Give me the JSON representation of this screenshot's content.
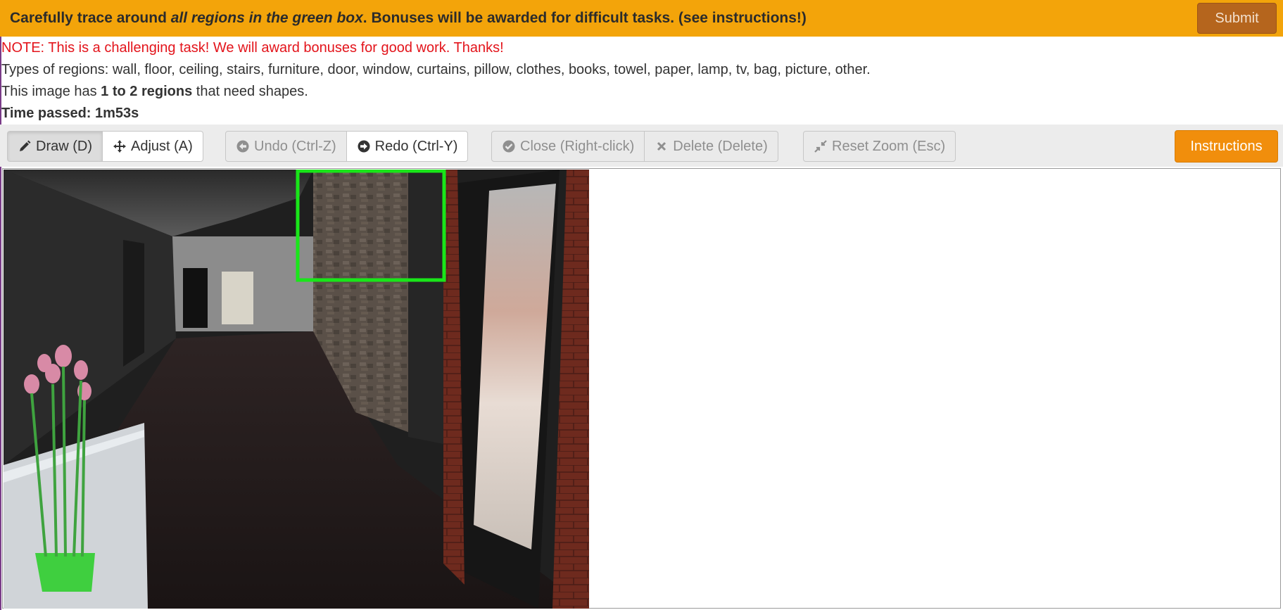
{
  "banner": {
    "part1": "Carefully trace around ",
    "emphasis": "all regions in the green box",
    "part2": ". Bonuses will be awarded for difficult tasks. (see instructions!)",
    "submit_label": "Submit"
  },
  "info": {
    "note": "NOTE: This is a challenging task! We will award bonuses for good work. Thanks!",
    "types": "Types of regions: wall, floor, ceiling, stairs, furniture, door, window, curtains, pillow, clothes, books, towel, paper, lamp, tv, bag, picture, other.",
    "regions_prefix": "This image has ",
    "regions_count": "1 to 2 regions",
    "regions_suffix": " that need shapes.",
    "time_passed": "Time passed: 1m53s"
  },
  "toolbar": {
    "draw_label": "Draw (D)",
    "adjust_label": "Adjust (A)",
    "undo_label": "Undo (Ctrl-Z)",
    "redo_label": "Redo (Ctrl-Y)",
    "close_label": "Close (Right-click)",
    "delete_label": "Delete (Delete)",
    "reset_zoom_label": "Reset Zoom (Esc)",
    "instructions_label": "Instructions"
  },
  "colors": {
    "banner": "#f3a40a",
    "submit": "#b5651d",
    "instructions": "#f18e0c",
    "note": "#e3141b",
    "target_box": "#19e619"
  },
  "icons": {
    "draw": "pencil-icon",
    "adjust": "move-arrows-icon",
    "undo": "arrow-circle-left-icon",
    "redo": "arrow-circle-right-icon",
    "close": "check-circle-icon",
    "delete": "x-icon",
    "reset_zoom": "compress-icon"
  }
}
